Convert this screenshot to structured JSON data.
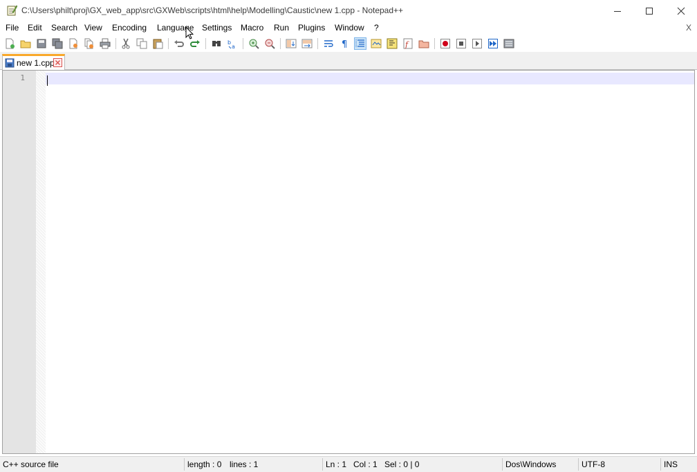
{
  "window": {
    "title": "C:\\Users\\philt\\proj\\GX_web_app\\src\\GXWeb\\scripts\\html\\help\\Modelling\\Caustic\\new 1.cpp - Notepad++",
    "minimize_icon": "minimize-icon",
    "maximize_icon": "maximize-icon",
    "close_icon": "close-icon"
  },
  "menubar": {
    "items": [
      "File",
      "Edit",
      "Search",
      "View",
      "Encoding",
      "Language",
      "Settings",
      "Macro",
      "Run",
      "Plugins",
      "Window",
      "?"
    ],
    "close_label": "X"
  },
  "toolbar": {
    "buttons": [
      "new-file-icon",
      "open-file-icon",
      "save-icon",
      "save-all-icon",
      "close-icon",
      "close-all-icon",
      "print-icon",
      "cut-icon",
      "copy-icon",
      "paste-icon",
      "undo-icon",
      "redo-icon",
      "find-icon",
      "replace-icon",
      "zoom-in-icon",
      "zoom-out-icon",
      "sync-vertical-icon",
      "sync-horizontal-icon",
      "word-wrap-icon",
      "show-all-characters-icon",
      "indent-guide-icon",
      "user-language-icon",
      "document-map-icon",
      "function-list-icon",
      "folder-as-workspace-icon",
      "record-macro-icon",
      "stop-recording-icon",
      "playback-macro-icon",
      "run-macro-multiple-icon",
      "save-macro-icon"
    ]
  },
  "tabs": [
    {
      "label": "new 1.cpp",
      "active": true
    }
  ],
  "editor": {
    "lines": [
      ""
    ],
    "line_numbers": [
      "1"
    ],
    "current_line_color": "#e8e8ff"
  },
  "statusbar": {
    "file_type": "C++ source file",
    "length": "length : 0",
    "lines": "lines : 1",
    "ln": "Ln : 1",
    "col": "Col : 1",
    "sel": "Sel : 0 | 0",
    "eol": "Dos\\Windows",
    "encoding": "UTF-8",
    "mode": "INS"
  },
  "colors": {
    "tab_accent": "#f9a82a",
    "gutter": "#e4e4e4",
    "status_bg": "#f0f0f0"
  }
}
